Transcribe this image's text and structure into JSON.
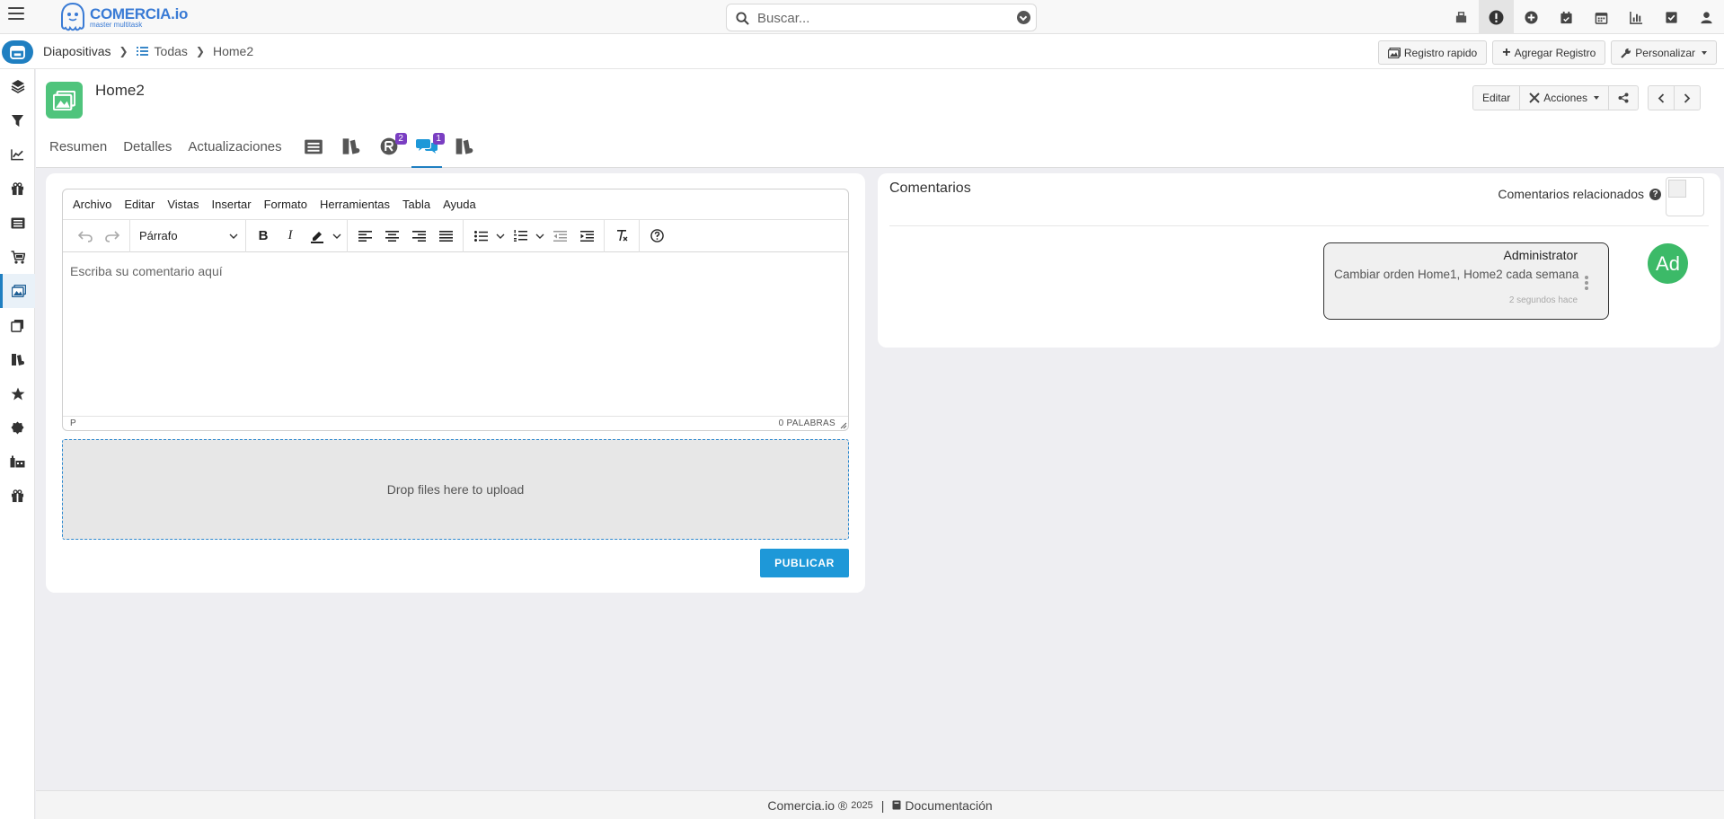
{
  "app": {
    "logo_name": "COMERCIA.io",
    "logo_tag": "master multitask",
    "search_placeholder": "Buscar..."
  },
  "breadcrumb": {
    "module": "Diapositivas",
    "list": "Todas",
    "record": "Home2"
  },
  "subbar_actions": {
    "quick_record": "Registro rapido",
    "add_record": "Agregar Registro",
    "customize": "Personalizar"
  },
  "record": {
    "title": "Home2",
    "edit": "Editar",
    "actions": "Acciones"
  },
  "tabs": [
    {
      "label": "Resumen"
    },
    {
      "label": "Detalles"
    },
    {
      "label": "Actualizaciones"
    }
  ],
  "tab_badges": {
    "activities": "2",
    "comments": "1"
  },
  "editor": {
    "menu": [
      "Archivo",
      "Editar",
      "Vistas",
      "Insertar",
      "Formato",
      "Herramientas",
      "Tabla",
      "Ayuda"
    ],
    "block_format": "Párrafo",
    "placeholder": "Escriba su comentario aquí",
    "path": "P",
    "word_count": "0 PALABRAS"
  },
  "dropzone": {
    "text": "Drop files here to upload"
  },
  "publish_label": "PUBLICAR",
  "comments": {
    "title": "Comentarios",
    "related_label": "Comentarios relacionados",
    "items": [
      {
        "author": "Administrator",
        "text": "Cambiar orden Home1, Home2 cada semana",
        "time": "2 segundos hace",
        "avatar_initials": "Ad"
      }
    ]
  },
  "footer": {
    "brand": "Comercia.io ®",
    "year": "2025",
    "doc_label": "Documentación"
  },
  "colors": {
    "primary": "#1f7fc1",
    "publish": "#1e98d8",
    "record_icon": "#4fc47c",
    "badge": "#7a3ec2",
    "avatar": "#3cba68"
  }
}
